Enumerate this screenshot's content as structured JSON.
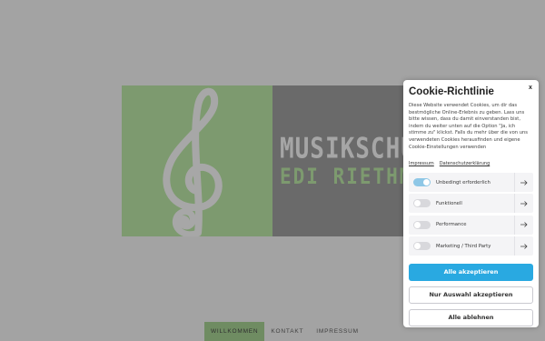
{
  "header": {
    "brand_line1": "MUSIKSCHULE",
    "brand_line2": "EDI RIETHMACHER"
  },
  "nav": {
    "items": [
      {
        "label": "WILLKOMMEN",
        "active": true
      },
      {
        "label": "KONTAKT",
        "active": false
      },
      {
        "label": "IMPRESSUM",
        "active": false
      }
    ]
  },
  "cookie": {
    "title": "Cookie-Richtlinie",
    "close_label": "x",
    "body": "Diese Website verwendet Cookies, um dir das bestmögliche Online-Erlebnis zu geben. Lass uns bitte wissen, dass du damit einverstanden bist, indem du weiter unten auf die Option \"Ja, ich stimme zu\" klickst. Falls du mehr über die von uns verwendeten Cookies herausfinden und eigene Cookie-Einstellungen verwenden",
    "links": {
      "impressum": "Impressum",
      "datenschutz": "Datenschutzerklärung"
    },
    "categories": [
      {
        "label": "Unbedingt erforderlich",
        "enabled": true
      },
      {
        "label": "Funktionell",
        "enabled": false
      },
      {
        "label": "Performance",
        "enabled": false
      },
      {
        "label": "Marketing / Third Party",
        "enabled": false
      }
    ],
    "buttons": {
      "accept_all": "Alle akzeptieren",
      "accept_selection": "Nur Auswahl akzeptieren",
      "reject_all": "Alle ablehnen"
    }
  },
  "colors": {
    "accent": "#29a9e1",
    "hero_green": "#7d9a6f",
    "hero_gray": "#6a6a6a",
    "toggle_on": "#8ec7e6"
  },
  "icons": {
    "clef": "treble-clef-icon",
    "row_arrow": "arrow-right-icon",
    "close": "close-icon"
  }
}
